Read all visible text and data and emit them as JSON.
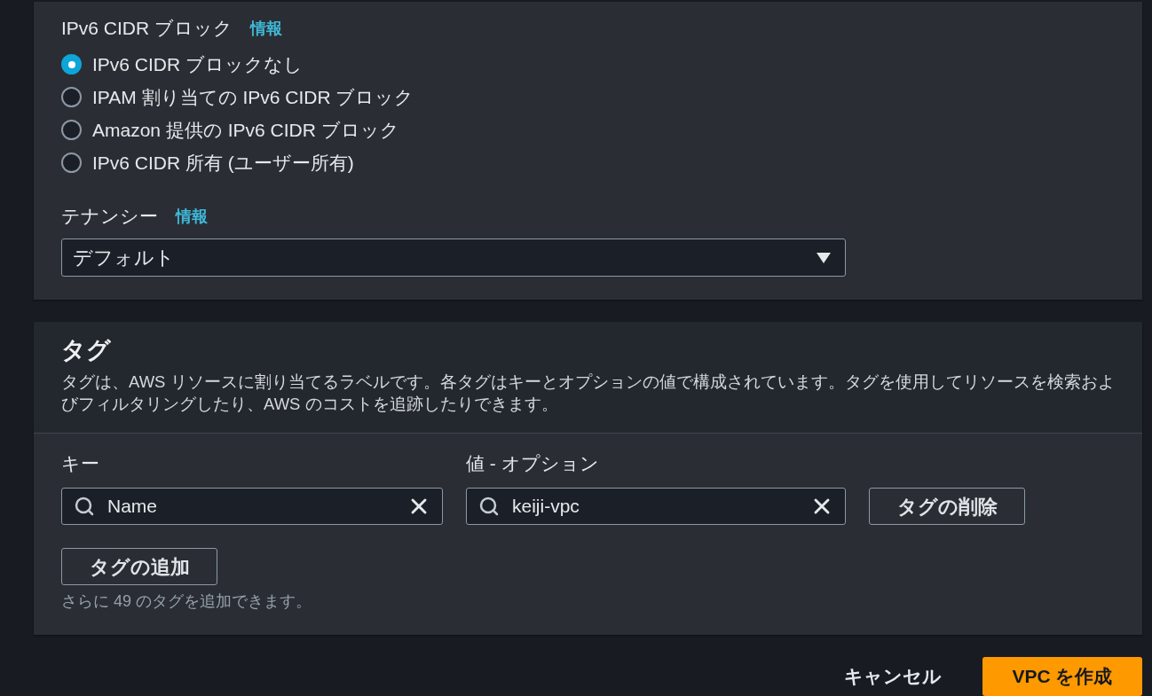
{
  "ipv6_cidr": {
    "label": "IPv6 CIDR ブロック",
    "info_link": "情報",
    "options": [
      {
        "label": "IPv6 CIDR ブロックなし",
        "selected": true
      },
      {
        "label": "IPAM 割り当ての IPv6 CIDR ブロック",
        "selected": false
      },
      {
        "label": "Amazon 提供の IPv6 CIDR ブロック",
        "selected": false
      },
      {
        "label": "IPv6 CIDR 所有 (ユーザー所有)",
        "selected": false
      }
    ]
  },
  "tenancy": {
    "label": "テナンシー",
    "info_link": "情報",
    "value": "デフォルト"
  },
  "tags": {
    "title": "タグ",
    "description": "タグは、AWS リソースに割り当てるラベルです。各タグはキーとオプションの値で構成されています。タグを使用してリソースを検索およびフィルタリングしたり、AWS のコストを追跡したりできます。",
    "key_label": "キー",
    "value_label": "値 - オプション",
    "rows": [
      {
        "key": "Name",
        "value": "keiji-vpc",
        "remove_button": "タグの削除"
      }
    ],
    "add_button": "タグの追加",
    "hint": "さらに 49 のタグを追加できます。"
  },
  "footer": {
    "cancel": "キャンセル",
    "submit": "VPC を作成"
  }
}
